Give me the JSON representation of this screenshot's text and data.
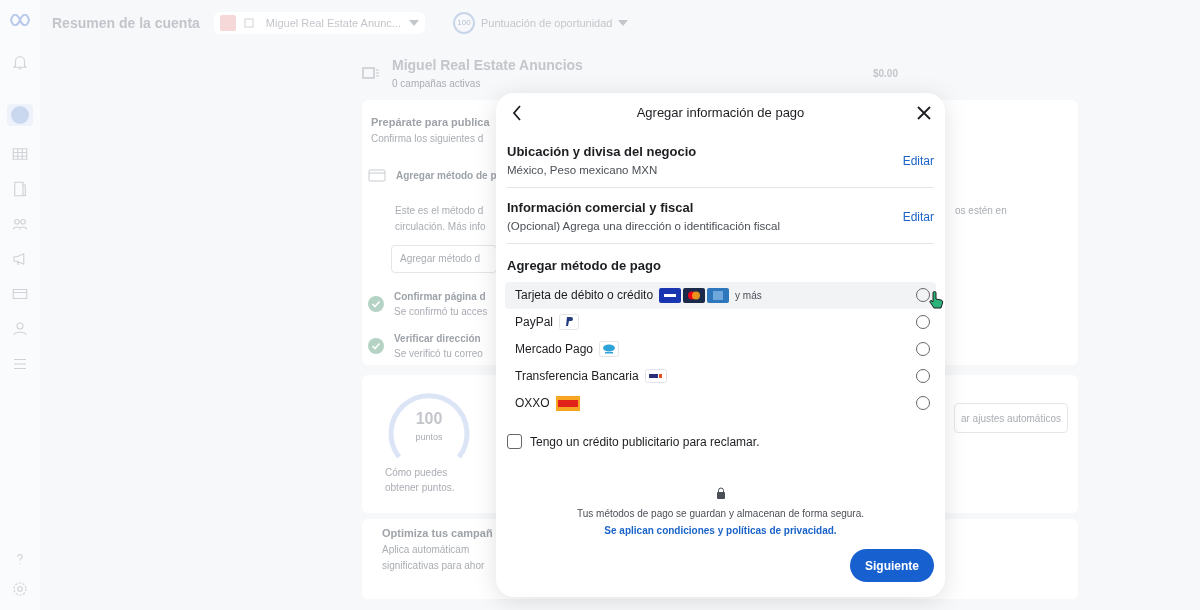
{
  "topbar": {
    "title": "Resumen de la cuenta",
    "account_selector": "Miguel Real Estate Anunc...",
    "score_badge": "100",
    "score_label": "Puntuación de oportunidad"
  },
  "sidebar": {
    "items": [
      {
        "kind": "bell",
        "selected": false
      },
      {
        "kind": "avatar",
        "selected": true
      },
      {
        "kind": "table",
        "selected": false
      },
      {
        "kind": "book",
        "selected": false
      },
      {
        "kind": "people",
        "selected": false
      },
      {
        "kind": "megaphone",
        "selected": false
      },
      {
        "kind": "card",
        "selected": false
      },
      {
        "kind": "person",
        "selected": false
      },
      {
        "kind": "menu",
        "selected": false
      }
    ],
    "bottom_items": [
      {
        "kind": "help"
      },
      {
        "kind": "settings"
      }
    ]
  },
  "account_header": {
    "name": "Miguel Real Estate Anuncios",
    "subtitle": "0 campañas activas",
    "spend_amount": "$0.00"
  },
  "setup_card": {
    "title": "Prepárate para publica",
    "subtitle": "Confirma los siguientes d",
    "steps": [
      {
        "kind": "payment",
        "title": "Agregar método de p",
        "lines": [
          "Este es el método d",
          "circulación. Más info"
        ],
        "button": "Agregar método d",
        "trailing": "os estén en"
      },
      {
        "kind": "done",
        "title": "Confirmar página d",
        "subtitle": "Se confirmó tu acces"
      },
      {
        "kind": "done",
        "title": "Verificar dirección",
        "subtitle": "Se verificó tu correo"
      }
    ]
  },
  "score_card": {
    "value": "100",
    "unit": "puntos",
    "hint": "Cómo puedes obtener puntos.",
    "button": "ar ajustes automáticos"
  },
  "optimize_card": {
    "title": "Optimiza tus campañ",
    "lines": [
      "Aplica automáticam",
      "significativas para ahor"
    ]
  },
  "dialog": {
    "title": "Agregar información de pago",
    "sections": [
      {
        "title": "Ubicación y divisa del negocio",
        "value": "México, Peso mexicano MXN",
        "action": "Editar"
      },
      {
        "title": "Información comercial y fiscal",
        "value": "(Opcional) Agrega una dirección o identificación fiscal",
        "action": "Editar"
      }
    ],
    "methods_title": "Agregar método de pago",
    "methods": [
      {
        "label": "Tarjeta de débito o crédito",
        "kind": "cards",
        "extra": "y más",
        "selected": false,
        "hovered": true
      },
      {
        "label": "PayPal",
        "kind": "paypal",
        "selected": false,
        "hovered": false
      },
      {
        "label": "Mercado Pago",
        "kind": "mercadopago",
        "selected": false,
        "hovered": false
      },
      {
        "label": "Transferencia Bancaria",
        "kind": "spei",
        "selected": false,
        "hovered": false
      },
      {
        "label": "OXXO",
        "kind": "oxxo",
        "selected": false,
        "hovered": false
      }
    ],
    "credit": {
      "label": "Tengo un crédito publicitario para reclamar.",
      "checked": false
    },
    "security_text": "Tus métodos de pago se guardan y almacenan de forma segura.",
    "privacy_link": "Se aplican condiciones y políticas de privacidad.",
    "next_button": "Siguiente"
  }
}
